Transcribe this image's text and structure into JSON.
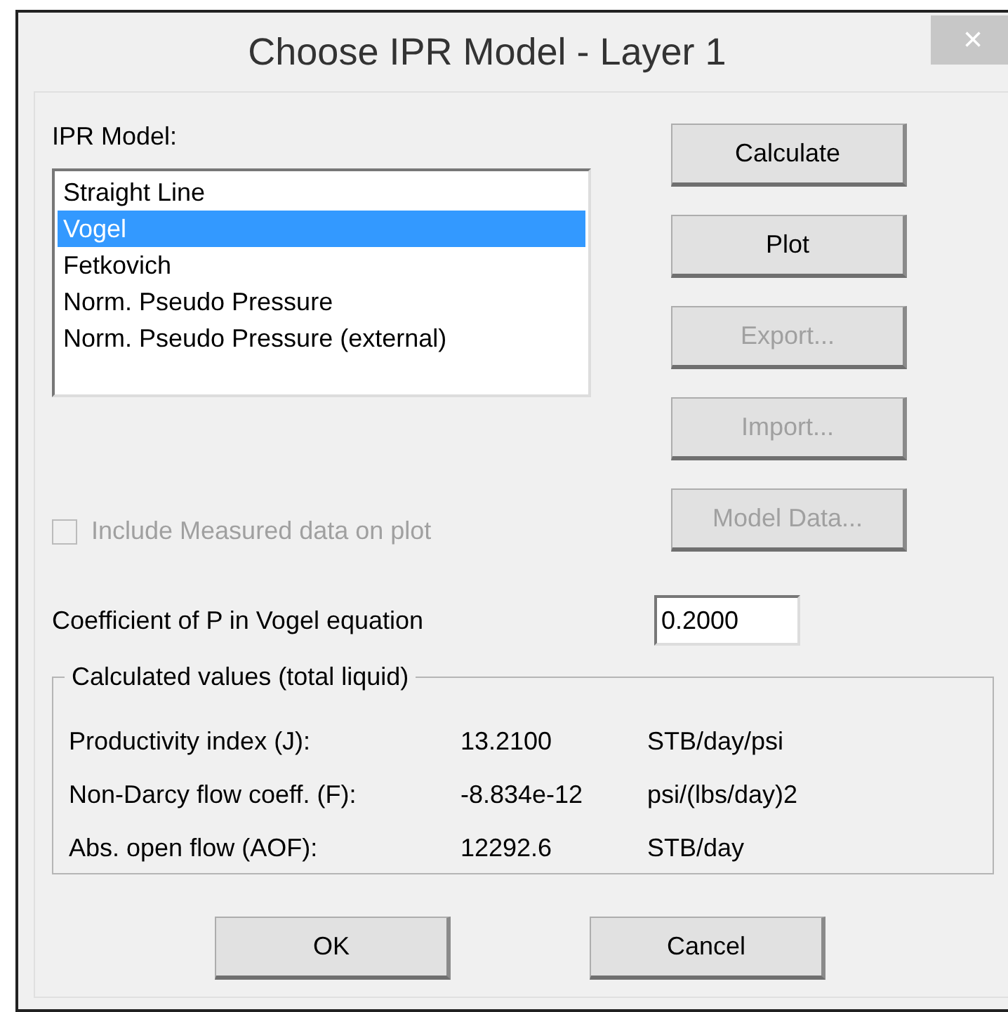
{
  "window": {
    "title": "Choose IPR Model - Layer 1",
    "close": "×"
  },
  "ipr_model": {
    "label": "IPR Model:",
    "items": [
      {
        "label": "Straight Line",
        "selected": false
      },
      {
        "label": "Vogel",
        "selected": true
      },
      {
        "label": "Fetkovich",
        "selected": false
      },
      {
        "label": "Norm. Pseudo Pressure",
        "selected": false
      },
      {
        "label": "Norm. Pseudo Pressure (external)",
        "selected": false
      }
    ]
  },
  "side_buttons": [
    {
      "label": "Calculate",
      "disabled": false
    },
    {
      "label": "Plot",
      "disabled": false
    },
    {
      "label": "Export...",
      "disabled": true
    },
    {
      "label": "Import...",
      "disabled": true
    },
    {
      "label": "Model Data...",
      "disabled": true
    }
  ],
  "include_measured": {
    "label": "Include Measured data on plot",
    "checked": false,
    "disabled": true
  },
  "coefficient": {
    "label": "Coefficient of P in Vogel equation",
    "value": "0.2000"
  },
  "calculated": {
    "title": "Calculated values (total liquid)",
    "rows": [
      {
        "label": "Productivity index (J):",
        "value": "13.2100",
        "unit": "STB/day/psi"
      },
      {
        "label": "Non-Darcy flow coeff. (F):",
        "value": "-8.834e-12",
        "unit": "psi/(lbs/day)2"
      },
      {
        "label": "Abs. open flow (AOF):",
        "value": "12292.6",
        "unit": "STB/day"
      }
    ]
  },
  "buttons": [
    "OK",
    "Cancel"
  ]
}
